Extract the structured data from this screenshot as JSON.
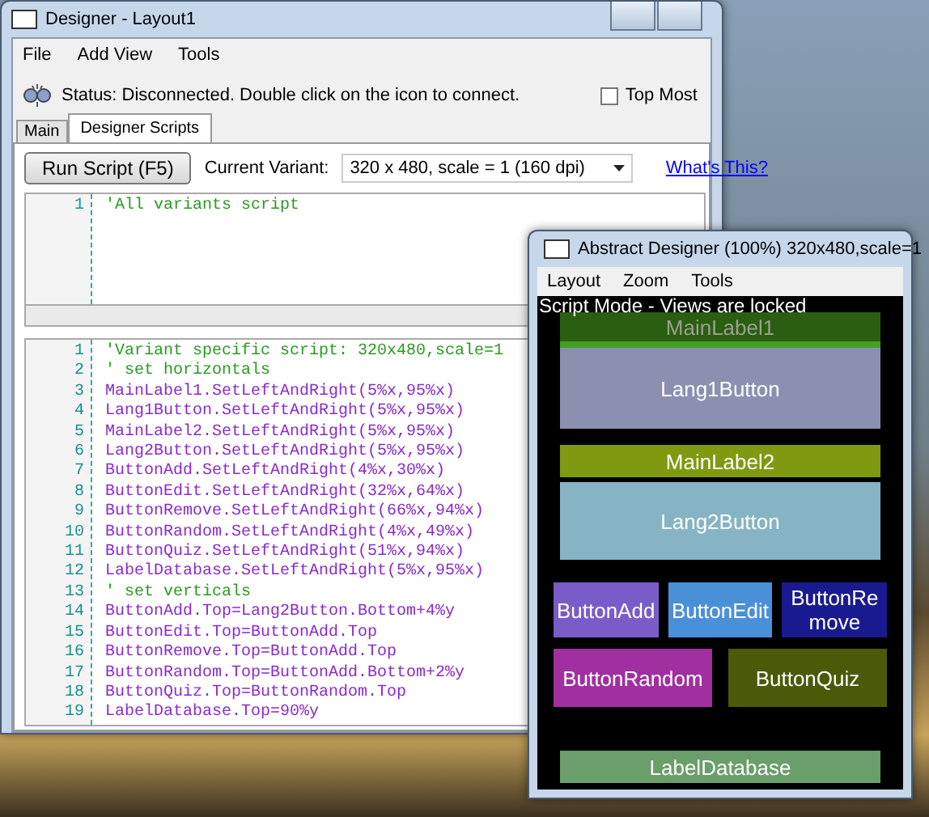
{
  "main_window": {
    "title": "Designer - Layout1",
    "menu": [
      "File",
      "Add View",
      "Tools"
    ],
    "status": "Status: Disconnected. Double click on the icon to connect.",
    "top_most": {
      "label": "Top Most",
      "checked": false
    },
    "tabs": [
      {
        "label": "Main",
        "selected": false
      },
      {
        "label": "Designer Scripts",
        "selected": true
      }
    ],
    "run_button": "Run Script (F5)",
    "variant_label": "Current Variant:",
    "variant_value": "320 x 480, scale = 1 (160 dpi)",
    "help_link": "What's This?",
    "all_variants_script": [
      {
        "number": "1",
        "text": "'All variants script",
        "kind": "comment"
      }
    ],
    "variant_script": [
      {
        "number": "1",
        "text": "'Variant specific script: 320x480,scale=1",
        "kind": "comment"
      },
      {
        "number": "2",
        "text": "' set horizontals",
        "kind": "comment"
      },
      {
        "number": "3",
        "text": "MainLabel1.SetLeftAndRight(5%x,95%x)",
        "kind": "code"
      },
      {
        "number": "4",
        "text": "Lang1Button.SetLeftAndRight(5%x,95%x)",
        "kind": "code"
      },
      {
        "number": "5",
        "text": "MainLabel2.SetLeftAndRight(5%x,95%x)",
        "kind": "code"
      },
      {
        "number": "6",
        "text": "Lang2Button.SetLeftAndRight(5%x,95%x)",
        "kind": "code"
      },
      {
        "number": "7",
        "text": "ButtonAdd.SetLeftAndRight(4%x,30%x)",
        "kind": "code"
      },
      {
        "number": "8",
        "text": "ButtonEdit.SetLeftAndRight(32%x,64%x)",
        "kind": "code"
      },
      {
        "number": "9",
        "text": "ButtonRemove.SetLeftAndRight(66%x,94%x)",
        "kind": "code"
      },
      {
        "number": "10",
        "text": "ButtonRandom.SetLeftAndRight(4%x,49%x)",
        "kind": "code"
      },
      {
        "number": "11",
        "text": "ButtonQuiz.SetLeftAndRight(51%x,94%x)",
        "kind": "code"
      },
      {
        "number": "12",
        "text": "LabelDatabase.SetLeftAndRight(5%x,95%x)",
        "kind": "code"
      },
      {
        "number": "13",
        "text": "' set verticals",
        "kind": "comment"
      },
      {
        "number": "14",
        "text": "ButtonAdd.Top=Lang2Button.Bottom+4%y",
        "kind": "code"
      },
      {
        "number": "15",
        "text": "ButtonEdit.Top=ButtonAdd.Top",
        "kind": "code"
      },
      {
        "number": "16",
        "text": "ButtonRemove.Top=ButtonAdd.Top",
        "kind": "code"
      },
      {
        "number": "17",
        "text": "ButtonRandom.Top=ButtonAdd.Bottom+2%y",
        "kind": "code"
      },
      {
        "number": "18",
        "text": "ButtonQuiz.Top=ButtonRandom.Top",
        "kind": "code"
      },
      {
        "number": "19",
        "text": "LabelDatabase.Top=90%y",
        "kind": "code"
      }
    ]
  },
  "abstract_designer": {
    "title": "Abstract Designer (100%) 320x480,scale=1",
    "menu": [
      "Layout",
      "Zoom",
      "Tools"
    ],
    "notice": "Script Mode - Views are locked",
    "rows": [
      [
        {
          "label": "MainLabel1",
          "color": "#2a5e10"
        }
      ],
      [
        {
          "label": "Lang1Button",
          "color": "#8b8fb0"
        }
      ],
      [
        {
          "label": "MainLabel2",
          "color": "#7e9a10"
        }
      ],
      [
        {
          "label": "Lang2Button",
          "color": "#86b4c4"
        }
      ],
      [
        {
          "label": "ButtonAdd",
          "color": "#7a5cc8"
        },
        {
          "label": "ButtonEdit",
          "color": "#4a90d8"
        },
        {
          "label": "ButtonRemove",
          "color": "#1a1a90"
        }
      ],
      [
        {
          "label": "ButtonRandom",
          "color": "#a030a0"
        },
        {
          "label": "ButtonQuiz",
          "color": "#4a5a08"
        }
      ],
      [
        {
          "label": "LabelDatabase",
          "color": "#6a9e6a"
        }
      ]
    ]
  }
}
